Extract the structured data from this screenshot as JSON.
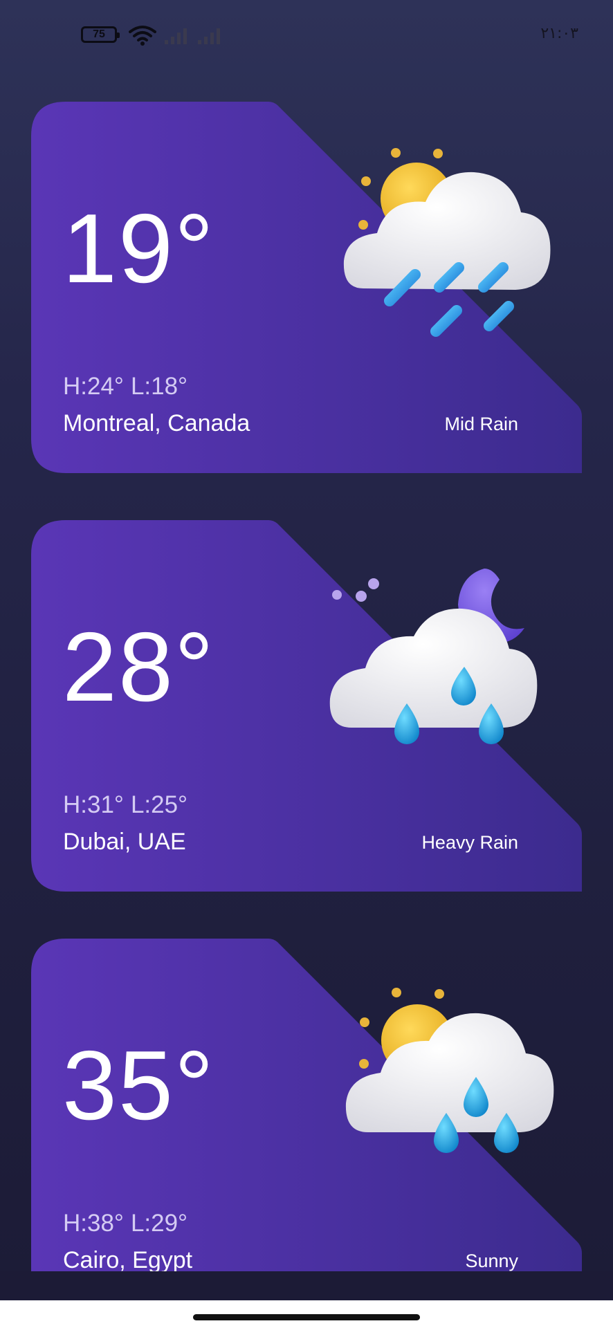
{
  "status_bar": {
    "battery": "75",
    "time": "٢١:٠٣",
    "icons": [
      "battery-icon",
      "wifi-icon",
      "signal-icon",
      "signal-icon"
    ]
  },
  "cards": [
    {
      "temperature": "19°",
      "high": "H:24°",
      "low": "L:18°",
      "city": "Montreal, Canada",
      "condition": "Mid Rain",
      "icon": "sun-cloud-rain-icon"
    },
    {
      "temperature": "28°",
      "high": "H:31°",
      "low": "L:25°",
      "city": "Dubai, UAE",
      "condition": "Heavy Rain",
      "icon": "moon-cloud-rain-icon"
    },
    {
      "temperature": "35°",
      "high": "H:38°",
      "low": "L:29°",
      "city": "Cairo, Egypt",
      "condition": "Sunny",
      "icon": "sun-cloud-drops-icon"
    }
  ],
  "colors": {
    "card_start": "#5b36b8",
    "card_end": "#3a2a8c",
    "background": "#25264a",
    "sun": "#f2c230",
    "moon": "#7b5ce6",
    "rain": "#2aa8e8"
  }
}
